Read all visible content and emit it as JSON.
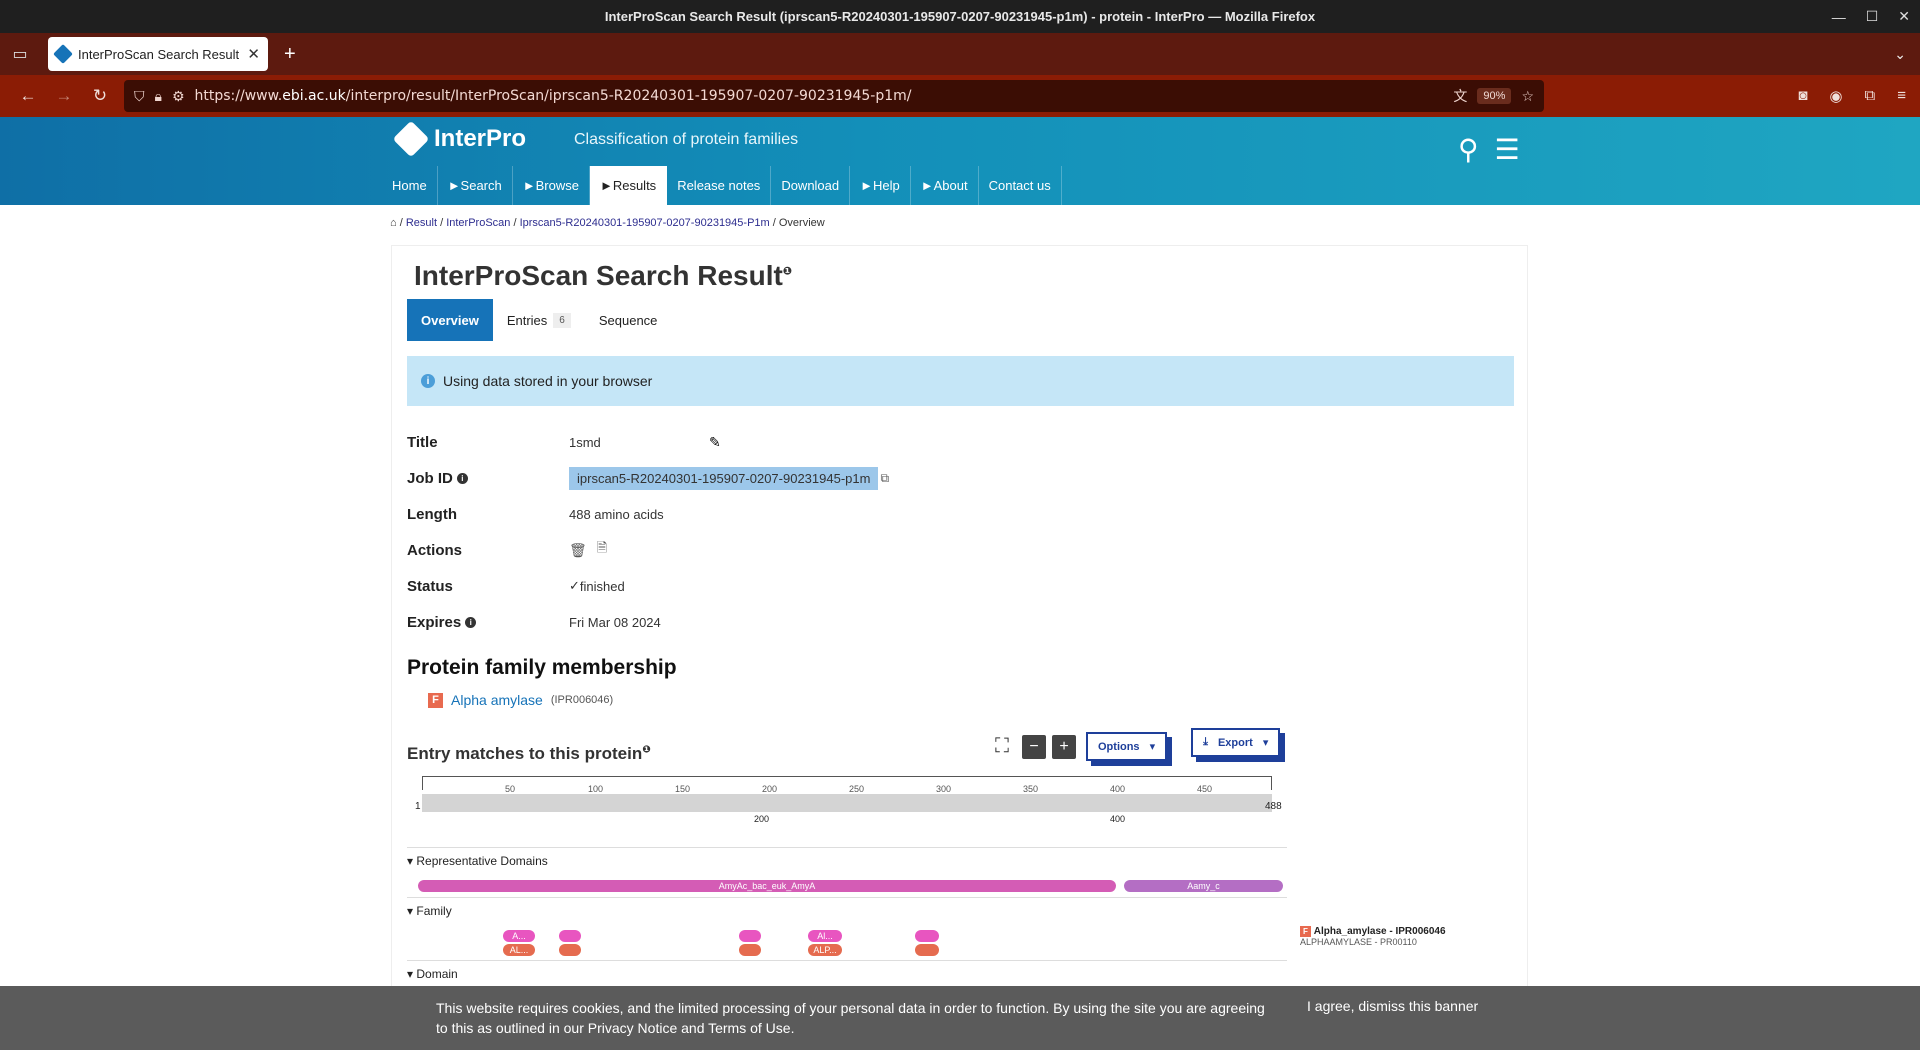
{
  "window": {
    "title": "InterProScan Search Result (iprscan5-R20240301-195907-0207-90231945-p1m) - protein - InterPro — Mozilla Firefox"
  },
  "browser": {
    "tab_title": "InterProScan Search Result",
    "url_prefix": "https://www.",
    "url_domain": "ebi.ac.uk",
    "url_rest": "/interpro/result/InterProScan/iprscan5-R20240301-195907-0207-90231945-p1m/",
    "zoom": "90%"
  },
  "site": {
    "logo": "InterPro",
    "tagline": "Classification of protein families",
    "nav": [
      "Home",
      "►Search",
      "►Browse",
      "►Results",
      "Release notes",
      "Download",
      "►Help",
      "►About",
      "Contact us"
    ]
  },
  "breadcrumb": {
    "result": "Result",
    "ips": "InterProScan",
    "job": "Iprscan5-R20240301-195907-0207-90231945-P1m",
    "current": "Overview"
  },
  "page": {
    "title": "InterProScan Search Result",
    "tabs": {
      "overview": "Overview",
      "entries": "Entries",
      "entries_count": "6",
      "sequence": "Sequence"
    },
    "callout": "Using data stored in your browser"
  },
  "props": {
    "title_k": "Title",
    "title_v": "1smd",
    "jobid_k": "Job ID",
    "jobid_v": "iprscan5-R20240301-195907-0207-90231945-p1m",
    "length_k": "Length",
    "length_v": "488 amino acids",
    "actions_k": "Actions",
    "status_k": "Status",
    "status_v": "finished",
    "expires_k": "Expires",
    "expires_v": "Fri Mar 08 2024"
  },
  "family": {
    "heading": "Protein family membership",
    "badge": "F",
    "name": "Alpha amylase",
    "acc": "(IPR006046)"
  },
  "matches": {
    "heading": "Entry matches to this protein",
    "options": "Options",
    "export": "Export",
    "ticks": [
      "50",
      "100",
      "150",
      "200",
      "250",
      "300",
      "350",
      "400",
      "450"
    ],
    "start": "1",
    "end": "488",
    "minor": [
      "200",
      "400"
    ],
    "rep_domains": "Representative Domains",
    "dom1": "AmyAc_bac_euk_AmyA",
    "dom2": "Aamy_c",
    "family_track": "Family",
    "domain_track": "Domain",
    "pill_a1": "A...",
    "pill_a2": "AL...",
    "pill_b1": "Al...",
    "pill_b2": "ALP...",
    "legend_name": "Alpha_amylase - IPR006046",
    "legend_sub": "ALPHAAMYLASE - PR00110"
  },
  "cookie": {
    "message": "This website requires cookies, and the limited processing of your personal data in order to function. By using the site you are agreeing to this as outlined in our Privacy Notice and Terms of Use.",
    "agree": "I agree, dismiss this banner"
  },
  "colors": {
    "brand_blue": "#1673b8",
    "browser_red": "#8b1c05",
    "domain_pink": "#d45cb5",
    "domain_purple": "#b46ec4",
    "family_pink": "#e855c0",
    "family_red": "#e56b4f"
  }
}
